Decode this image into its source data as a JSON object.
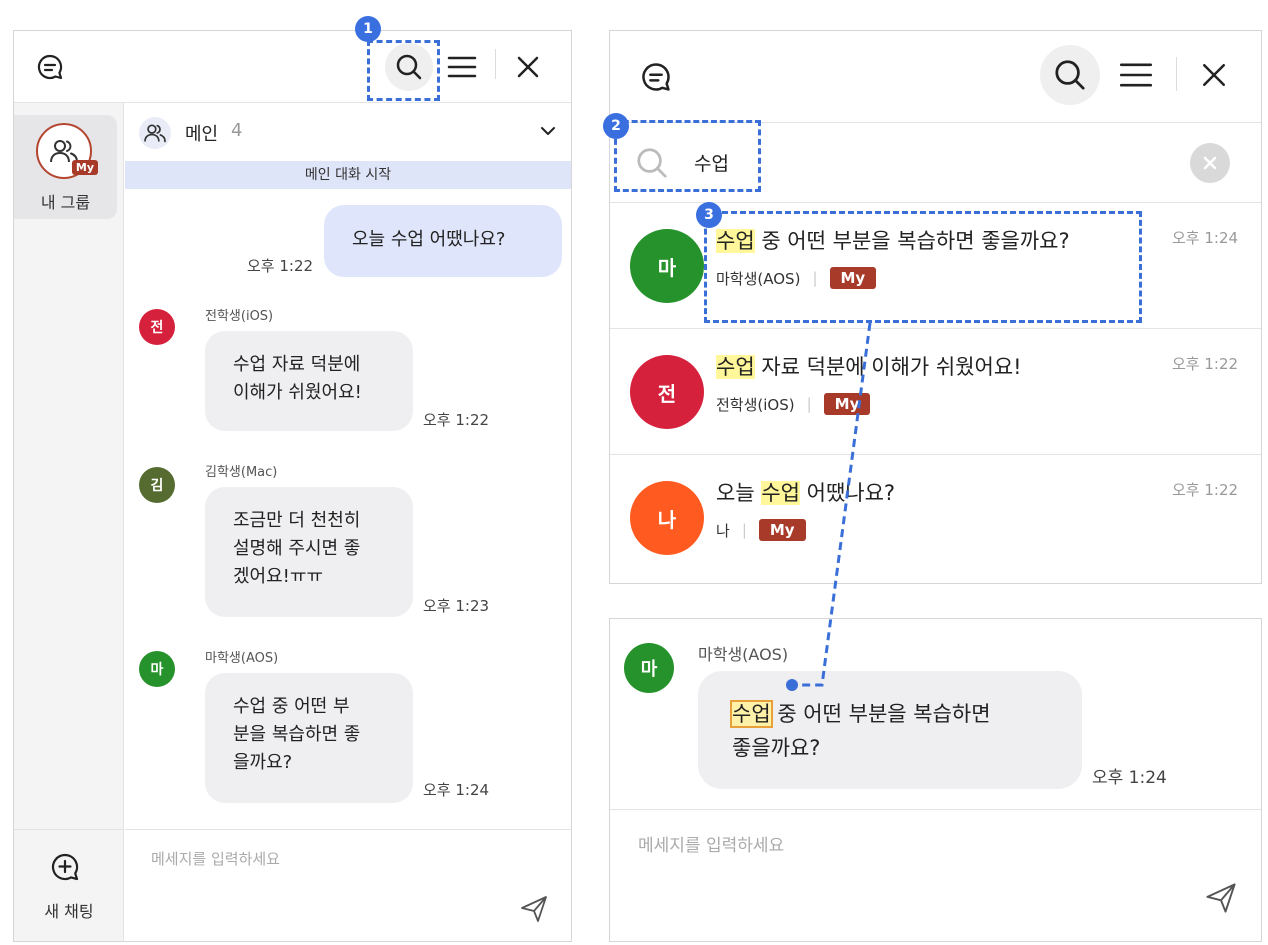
{
  "left": {
    "sidebar": {
      "group_label": "내 그룹",
      "group_badge": "My",
      "new_chat_label": "새 채팅"
    },
    "channel": {
      "name": "메인",
      "count": "4",
      "start_banner": "메인 대화 시작"
    },
    "messages": [
      {
        "mine": true,
        "text": "오늘 수업 어땠나요?",
        "time": "오후 1:22"
      },
      {
        "sender": "전학생(iOS)",
        "initial": "전",
        "color": "#d6213d",
        "lines": [
          "수업 자료 덕분에",
          "이해가 쉬웠어요!"
        ],
        "time": "오후 1:22"
      },
      {
        "sender": "김학생(Mac)",
        "initial": "김",
        "color": "#556b2f",
        "lines": [
          "조금만 더 천천히",
          "설명해 주시면 좋",
          "겠어요!ㅠㅠ"
        ],
        "time": "오후 1:23"
      },
      {
        "sender": "마학생(AOS)",
        "initial": "마",
        "color": "#25922b",
        "lines": [
          "수업 중 어떤 부",
          "분을 복습하면 좋",
          "을까요?"
        ],
        "time": "오후 1:24"
      }
    ],
    "composer": {
      "placeholder": "메세지를 입력하세요"
    }
  },
  "right_top": {
    "search": {
      "query": "수업"
    },
    "results": [
      {
        "initial": "마",
        "color": "#25922b",
        "pre": "",
        "match": "수업",
        "post": " 중 어떤 부분을 복습하면 좋을까요?",
        "sender": "마학생(AOS)",
        "badge": "My",
        "time": "오후 1:24"
      },
      {
        "initial": "전",
        "color": "#d6213d",
        "pre": "",
        "match": "수업",
        "post": " 자료 덕분에 이해가 쉬웠어요!",
        "sender": "전학생(iOS)",
        "badge": "My",
        "time": "오후 1:22"
      },
      {
        "initial": "나",
        "color": "#ff5a1f",
        "pre": "오늘 ",
        "match": "수업",
        "post": " 어땠나요?",
        "sender": "나",
        "badge": "My",
        "time": "오후 1:22"
      }
    ]
  },
  "right_bottom": {
    "message": {
      "sender": "마학생(AOS)",
      "initial": "마",
      "color": "#25922b",
      "match": "수업",
      "line1_rest": " 중 어떤 부분을 복습하면",
      "line2": "좋을까요?",
      "time": "오후 1:24"
    },
    "composer": {
      "placeholder": "메세지를 입력하세요"
    }
  },
  "annotations": {
    "markers": [
      "1",
      "2",
      "3"
    ],
    "color": "#3b6fd8"
  }
}
